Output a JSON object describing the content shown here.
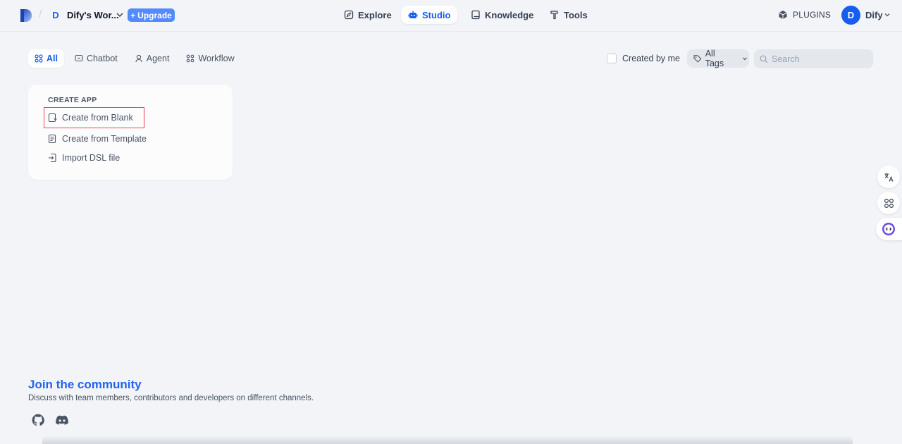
{
  "header": {
    "workspace_initial": "D",
    "workspace_name": "Dify's Wor...",
    "upgrade_label": "Upgrade",
    "nav": [
      {
        "label": "Explore",
        "icon": "compass-icon"
      },
      {
        "label": "Studio",
        "icon": "robot-icon",
        "active": true
      },
      {
        "label": "Knowledge",
        "icon": "book-icon"
      },
      {
        "label": "Tools",
        "icon": "hammer-icon"
      }
    ],
    "plugins_label": "PLUGINS",
    "user_initial": "D",
    "user_name": "Dify"
  },
  "tabs": [
    {
      "label": "All",
      "active": true
    },
    {
      "label": "Chatbot"
    },
    {
      "label": "Agent"
    },
    {
      "label": "Workflow"
    }
  ],
  "filters": {
    "created_by_me_label": "Created by me",
    "created_by_me_checked": false,
    "tags_label": "All Tags",
    "search_placeholder": "Search"
  },
  "create_app": {
    "title": "CREATE APP",
    "items": [
      {
        "label": "Create from Blank"
      },
      {
        "label": "Create from Template"
      },
      {
        "label": "Import DSL file"
      }
    ]
  },
  "community": {
    "title": "Join the community",
    "description": "Discuss with team members, contributors and developers on different channels."
  },
  "colors": {
    "accent": "#155eef",
    "upgrade": "#528bff",
    "background": "#f2f4f7",
    "highlight": "#e5484d"
  }
}
